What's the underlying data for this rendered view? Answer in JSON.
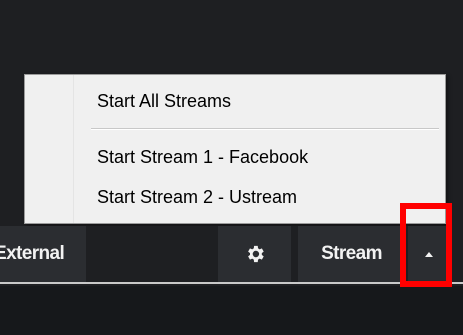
{
  "menu": {
    "items": [
      {
        "label": "Start All Streams"
      },
      {
        "label": "Start Stream 1 - Facebook"
      },
      {
        "label": "Start Stream 2 - Ustream"
      }
    ]
  },
  "toolbar": {
    "external_label": "External",
    "settings_icon": "gear-icon",
    "stream_label": "Stream",
    "dropdown_icon": "caret-up-icon"
  },
  "colors": {
    "background": "#1e1f22",
    "button": "#2b2d31",
    "menu": "#f0f0f0",
    "highlight": "#ff0000"
  }
}
